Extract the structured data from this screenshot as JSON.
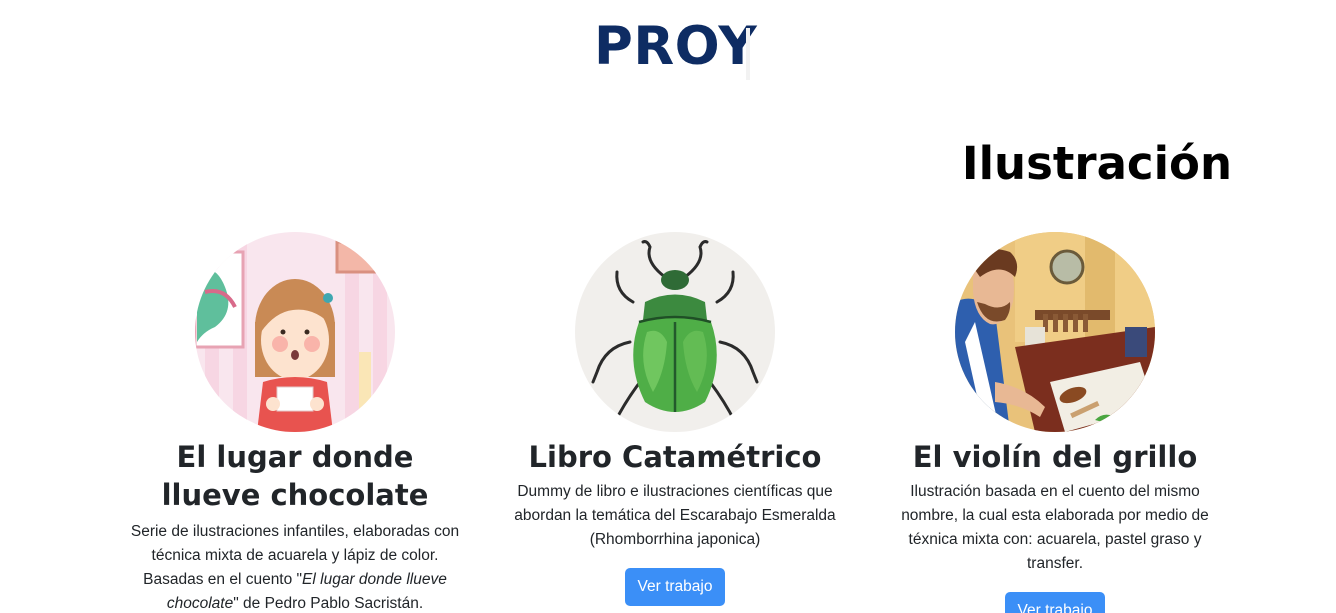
{
  "header": {
    "title": "PROY"
  },
  "section": {
    "title": "Ilustración"
  },
  "cards": [
    {
      "title": "El lugar donde llueve chocolate",
      "desc_pre": "Serie de ilustraciones infantiles, elaboradas con técnica mixta de acuarela y lápiz de color. Basadas en el cuento \"",
      "desc_em": "El lugar donde llueve chocolate",
      "desc_post": "\" de Pedro Pablo Sacristán.",
      "image_icon": "girl-illustration"
    },
    {
      "title": "Libro Catamétrico",
      "desc": "Dummy de libro e ilustraciones científicas que abordan la temática del Escarabajo Esmeralda (Rhomborrhina japonica)",
      "button": "Ver trabajo",
      "image_icon": "beetle-illustration"
    },
    {
      "title": "El violín del grillo",
      "desc": "Ilustración basada en el cuento del mismo nombre, la cual esta elaborada por medio de téxnica mixta con: acuarela, pastel graso y transfer.",
      "button": "Ver trabajo",
      "image_icon": "violin-maker-illustration"
    }
  ],
  "colors": {
    "header": "#0e2c63",
    "button": "#3b8ff7",
    "text": "#212529"
  }
}
